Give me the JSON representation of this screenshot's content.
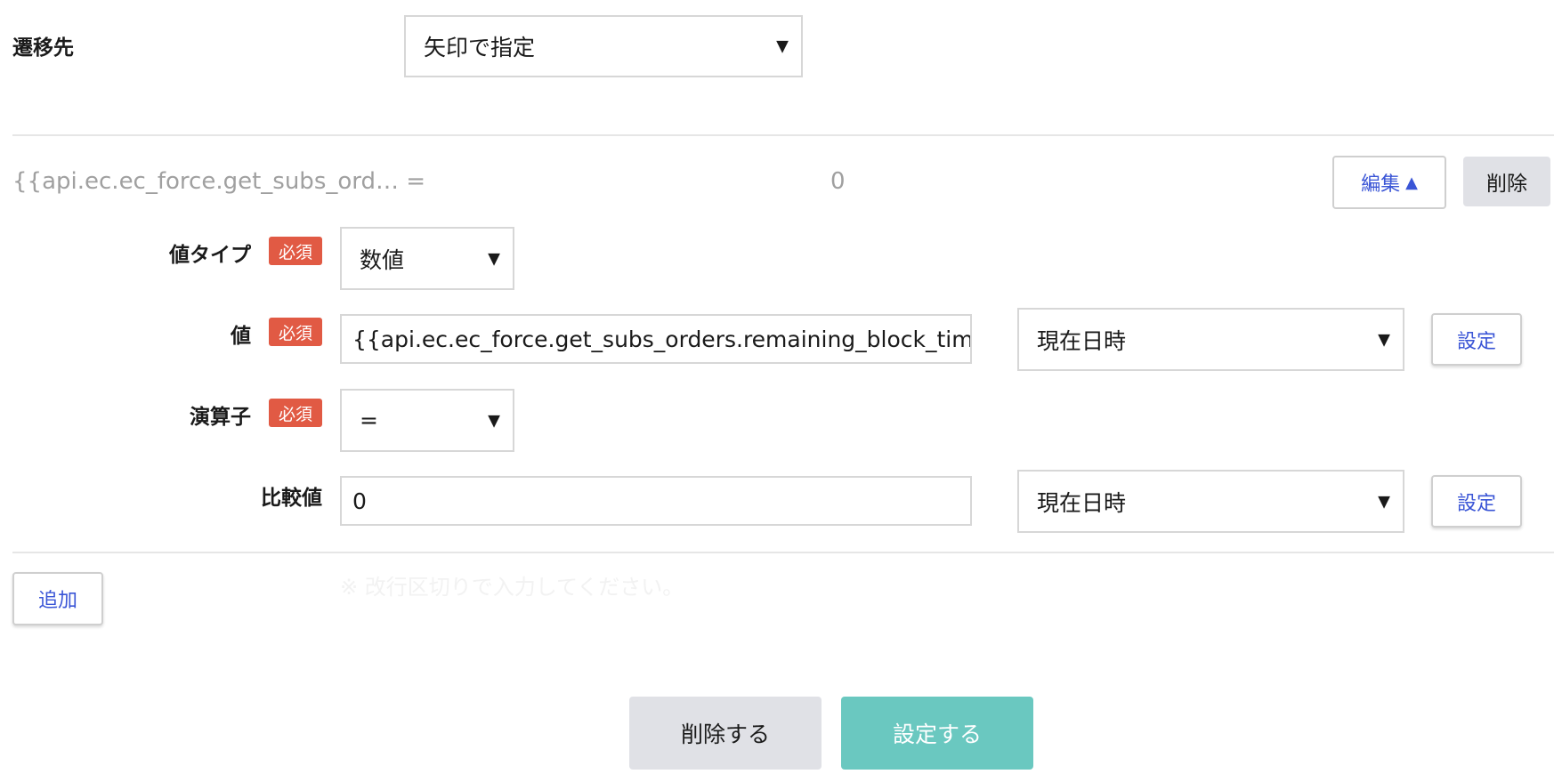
{
  "transition": {
    "label": "遷移先",
    "select_value": "矢印で指定"
  },
  "condition": {
    "summary_expression": "{{api.ec.ec_force.get_subs_ord… =",
    "summary_value": "0",
    "edit_label": "編集",
    "edit_icon": "▲",
    "delete_label": "削除"
  },
  "form": {
    "required_badge": "必須",
    "value_type": {
      "label": "値タイプ",
      "select_value": "数値"
    },
    "value": {
      "label": "値",
      "input_value": "{{api.ec.ec_force.get_subs_orders.remaining_block_tim",
      "datetime_select": "現在日時",
      "set_label": "設定"
    },
    "operator": {
      "label": "演算子",
      "select_value": "="
    },
    "compare": {
      "label": "比較値",
      "input_value": "0",
      "datetime_select": "現在日時",
      "set_label": "設定"
    },
    "hint": "※ 改行区切りで入力してください。"
  },
  "actions": {
    "add_label": "追加",
    "delete_label": "削除する",
    "save_label": "設定する"
  },
  "colors": {
    "required_badge": "#e15a44",
    "link_blue": "#3a55d6",
    "save_button": "#6ac8c0",
    "gray_button": "#e0e1e6"
  }
}
